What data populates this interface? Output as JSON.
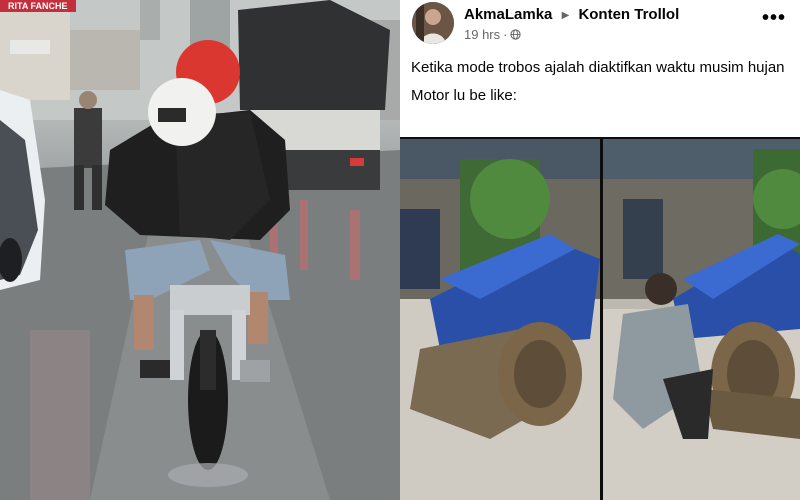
{
  "left_photo": {
    "shop_sign": "RITA FANCHE"
  },
  "post": {
    "author": "AkmaLamka",
    "group": "Konten Trollol",
    "time": "19 hrs",
    "audience_icon": "globe-icon",
    "more_icon": "ellipsis-icon",
    "text_lines": [
      "Ketika mode trobos ajalah diaktifkan waktu musim hujan",
      "Motor lu be like:"
    ]
  }
}
